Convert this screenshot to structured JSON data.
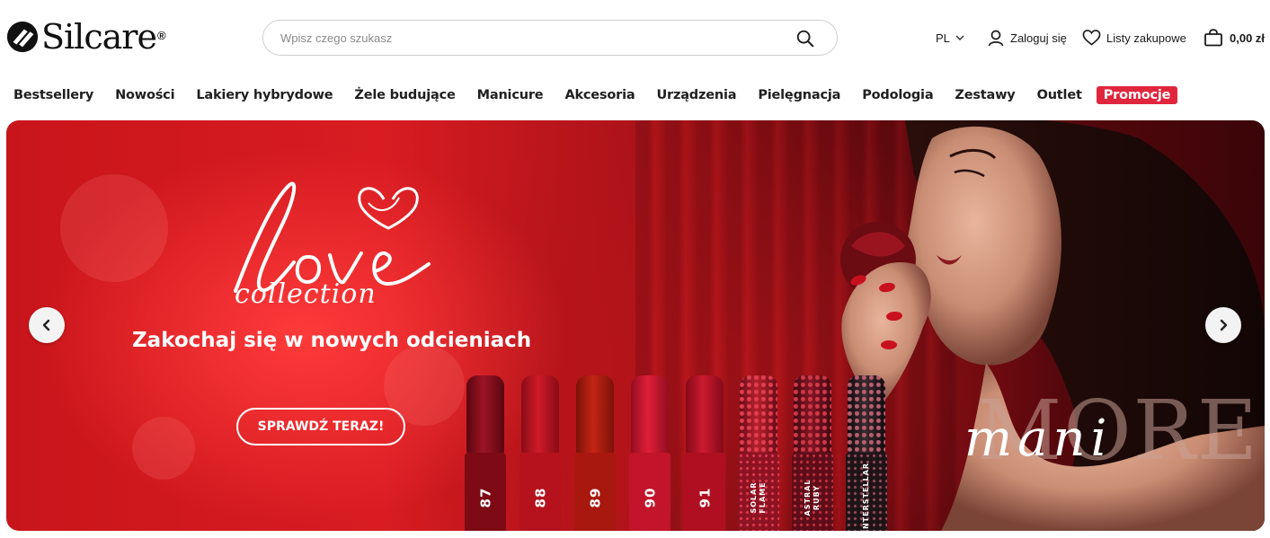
{
  "header": {
    "logo_text": "Silcare",
    "logo_mark": "®",
    "search_placeholder": "Wpisz czego szukasz",
    "search_icon": "search-icon",
    "language": "PL",
    "login_label": "Zaloguj się",
    "shopping_lists_label": "Listy zakupowe",
    "cart_total": "0,00 zł"
  },
  "nav": {
    "items": [
      "Bestsellery",
      "Nowości",
      "Lakiery hybrydowe",
      "Żele budujące",
      "Manicure",
      "Akcesoria",
      "Urządzenia",
      "Pielęgnacja",
      "Podologia",
      "Zestawy",
      "Outlet"
    ],
    "promo_label": "Promocje",
    "promo_color": "#e0263d"
  },
  "banner": {
    "script_title": "love",
    "script_subtitle": "collection",
    "headline": "Zakochaj się w nowych odcieniach",
    "cta_label": "SPRAWDŹ TERAZ!",
    "brand_more": "MORE",
    "brand_mani": "mani",
    "bottles": [
      {
        "label": "87",
        "color": "#7d0a14"
      },
      {
        "label": "88",
        "color": "#b5121e"
      },
      {
        "label": "89",
        "color": "#a8180f"
      },
      {
        "label": "90",
        "color": "#c2142a"
      },
      {
        "label": "91",
        "color": "#b00f22"
      },
      {
        "label": "SOLAR FLAME",
        "color": "#8d1222"
      },
      {
        "label": "ASTRAL RUBY",
        "color": "#5e0d18"
      },
      {
        "label": "INTERSTELLAR",
        "color": "#1e1418"
      }
    ]
  }
}
